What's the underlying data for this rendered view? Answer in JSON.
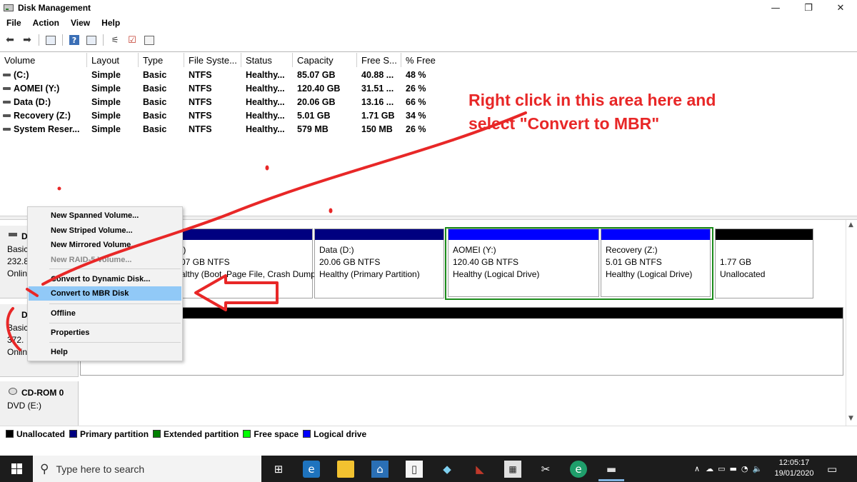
{
  "window": {
    "title": "Disk Management",
    "controls": {
      "minimize": "—",
      "restore": "❐",
      "close": "✕"
    }
  },
  "menu": [
    "File",
    "Action",
    "View",
    "Help"
  ],
  "toolbar": {
    "icons": [
      "back-arrow-icon",
      "forward-arrow-icon",
      "console-tree-icon",
      "help-icon",
      "properties-icon",
      "rescan-icon",
      "checklist-icon",
      "settings-icon"
    ]
  },
  "volume_table": {
    "columns": [
      "Volume",
      "Layout",
      "Type",
      "File Syste...",
      "Status",
      "Capacity",
      "Free S...",
      "% Free"
    ],
    "rows": [
      [
        "(C:)",
        "Simple",
        "Basic",
        "NTFS",
        "Healthy...",
        "85.07 GB",
        "40.88 ...",
        "48 %"
      ],
      [
        "AOMEI (Y:)",
        "Simple",
        "Basic",
        "NTFS",
        "Healthy...",
        "120.40 GB",
        "31.51 ...",
        "26 %"
      ],
      [
        "Data (D:)",
        "Simple",
        "Basic",
        "NTFS",
        "Healthy...",
        "20.06 GB",
        "13.16 ...",
        "66 %"
      ],
      [
        "Recovery (Z:)",
        "Simple",
        "Basic",
        "NTFS",
        "Healthy...",
        "5.01 GB",
        "1.71 GB",
        "34 %"
      ],
      [
        "System Reser...",
        "Simple",
        "Basic",
        "NTFS",
        "Healthy...",
        "579 MB",
        "150 MB",
        "26 %"
      ]
    ]
  },
  "disks": {
    "disk0": {
      "name": "D",
      "type": "Basic",
      "size": "232.8",
      "status": "Onlin"
    },
    "disk1": {
      "name": "D",
      "type": "Basic",
      "size": "372.",
      "status": "Onlin"
    },
    "cdrom": {
      "name": "CD-ROM 0",
      "type": "DVD (E:)"
    }
  },
  "partitions": {
    "c": {
      "line1": ":)",
      "line2": "07 GB NTFS",
      "line3": "althy (Boot, Page File, Crash Dump"
    },
    "data": {
      "line1": "Data  (D:)",
      "line2": "20.06 GB NTFS",
      "line3": "Healthy (Primary Partition)"
    },
    "aomei": {
      "line1": "AOMEI  (Y:)",
      "line2": "120.40 GB NTFS",
      "line3": "Healthy (Logical Drive)"
    },
    "recovery": {
      "line1": "Recovery  (Z:)",
      "line2": "5.01 GB NTFS",
      "line3": "Healthy (Logical Drive)"
    },
    "unalloc": {
      "line2": "1.77 GB",
      "line3": "Unallocated"
    }
  },
  "legend": {
    "items": [
      {
        "label": "Unallocated",
        "color": "#000000"
      },
      {
        "label": "Primary partition",
        "color": "#000080"
      },
      {
        "label": "Extended partition",
        "color": "#008000"
      },
      {
        "label": "Free space",
        "color": "#00ff00"
      },
      {
        "label": "Logical drive",
        "color": "#0000ff"
      }
    ]
  },
  "context_menu": {
    "items": [
      {
        "label": "New Spanned Volume...",
        "state": "enabled"
      },
      {
        "label": "New Striped Volume...",
        "state": "enabled"
      },
      {
        "label": "New Mirrored Volume...",
        "state": "enabled"
      },
      {
        "label": "New RAID-5 Volume...",
        "state": "disabled"
      },
      {
        "label": "Convert to Dynamic Disk...",
        "state": "enabled"
      },
      {
        "label": "Convert to MBR Disk",
        "state": "selected"
      },
      {
        "label": "Offline",
        "state": "enabled"
      },
      {
        "label": "Properties",
        "state": "enabled"
      },
      {
        "label": "Help",
        "state": "enabled"
      }
    ]
  },
  "annotation": {
    "line1": "Right click in this area here and",
    "line2": "select \"Convert to MBR\"",
    "color": "#e82727"
  },
  "taskbar": {
    "search_placeholder": "Type here to search",
    "apps": [
      "task-view-icon",
      "edge-legacy-icon",
      "file-explorer-icon",
      "bank-app-icon",
      "document-icon",
      "prism-icon",
      "visual-studio-icon",
      "calculator-icon",
      "snipping-tool-icon",
      "edge-dev-icon",
      "disk-management-icon"
    ],
    "time": "12:05:17",
    "date": "19/01/2020"
  }
}
